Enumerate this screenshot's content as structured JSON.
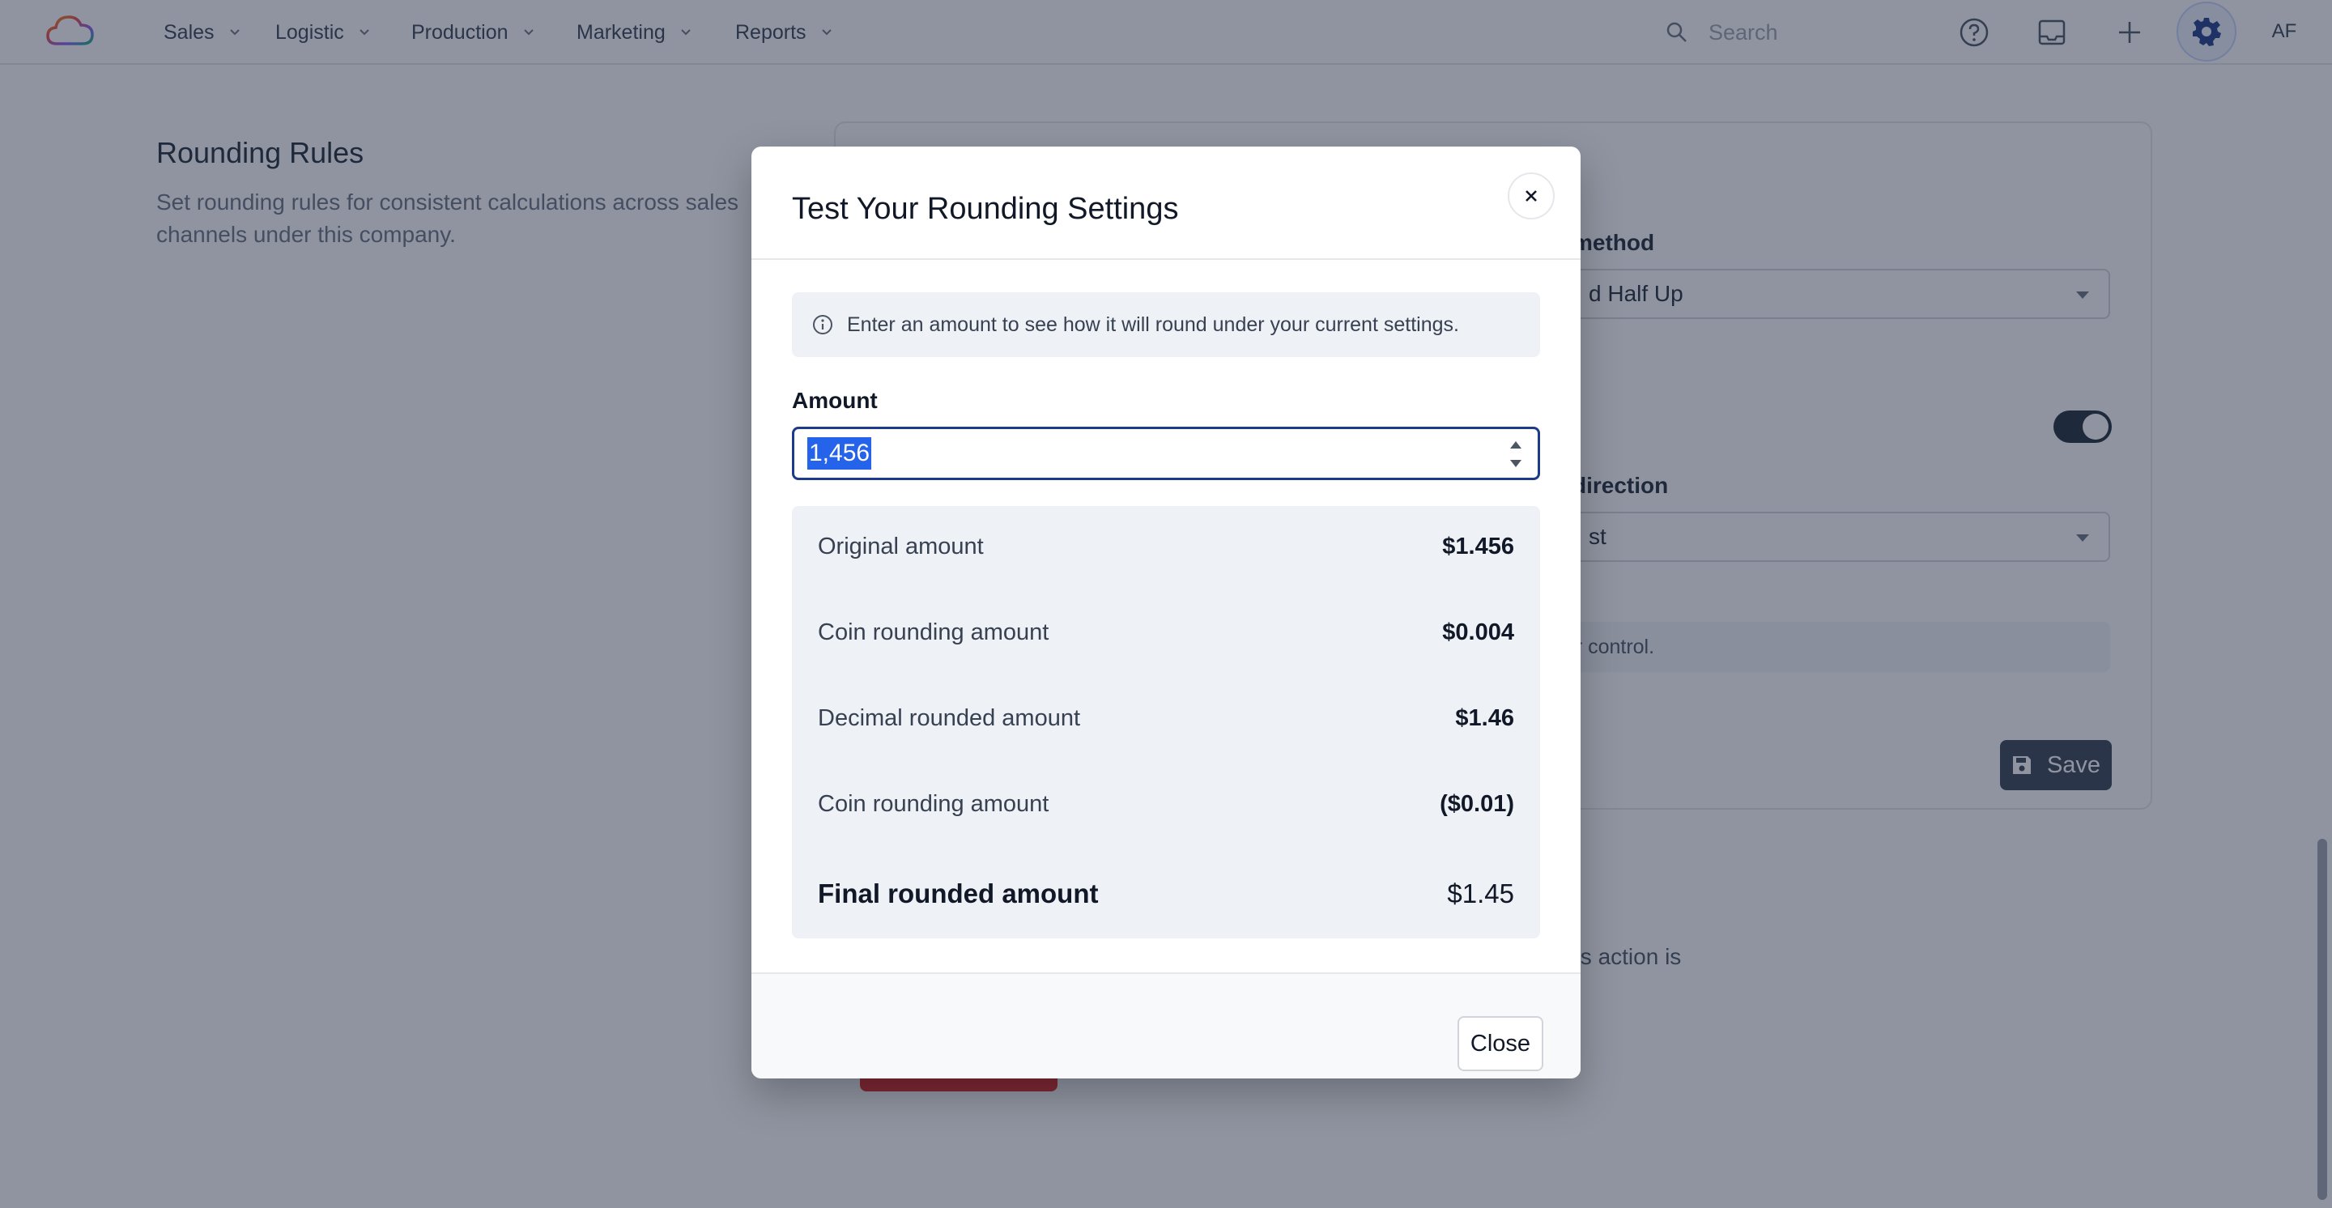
{
  "nav": {
    "items": [
      {
        "label": "Sales"
      },
      {
        "label": "Logistic"
      },
      {
        "label": "Production"
      },
      {
        "label": "Marketing"
      },
      {
        "label": "Reports"
      }
    ],
    "search_placeholder": "Search",
    "avatar_initials": "AF"
  },
  "page": {
    "section_title": "Rounding Rules",
    "section_description": "Set rounding rules for consistent calculations across sales channels under this company.",
    "rounding_method_label": "ng method",
    "rounding_method_value": "d Half Up",
    "rounding_direction_label": "ng direction",
    "rounding_direction_value": "st",
    "info_strip_text": "ner control.",
    "save_label": "Save",
    "danger_desc_fragment": "his action is"
  },
  "modal": {
    "title": "Test Your Rounding Settings",
    "notice": "Enter an amount to see how it will round under your current settings.",
    "amount_label": "Amount",
    "amount_value": "1,456",
    "rows": [
      {
        "label": "Original amount",
        "value": "$1.456"
      },
      {
        "label": "Coin rounding amount",
        "value": "$0.004"
      },
      {
        "label": "Decimal rounded amount",
        "value": "$1.46"
      },
      {
        "label": "Coin rounding amount",
        "value": "($0.01)"
      }
    ],
    "final": {
      "label": "Final rounded amount",
      "value": "$1.45"
    },
    "close_label": "Close"
  }
}
